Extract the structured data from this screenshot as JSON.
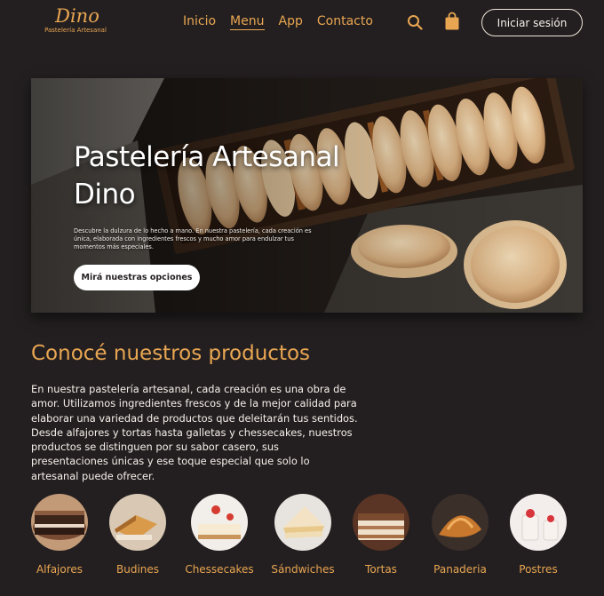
{
  "brand": {
    "name": "Dino",
    "tagline": "Pastelería Artesanal"
  },
  "nav": {
    "items": [
      "Inicio",
      "Menu",
      "App",
      "Contacto"
    ],
    "active": "Menu"
  },
  "header": {
    "search_icon": "search-icon",
    "cart_icon": "shopping-bag-icon",
    "login_label": "Iniciar sesión"
  },
  "colors": {
    "accent": "#e9a652",
    "background": "#231f20",
    "text": "#f5f0ea"
  },
  "hero": {
    "title": "Pastelería Artesanal Dino",
    "description": "Descubre la dulzura de lo hecho a mano. En nuestra pastelería, cada creación es única, elaborada con ingredientes frescos y mucho amor para endulzar tus momentos más especiales.",
    "cta": "Mirá nuestras opciones"
  },
  "products_section": {
    "title": "Conocé nuestros productos",
    "text": "En nuestra pastelería artesanal, cada creación es una obra de amor. Utilizamos ingredientes frescos y de la mejor calidad para elaborar una variedad de productos que deleitarán tus sentidos. Desde alfajores y tortas hasta galletas y chessecakes, nuestros productos se distinguen por su sabor casero, sus presentaciones únicas y ese toque especial que solo lo artesanal puede ofrecer.",
    "categories": [
      "Alfajores",
      "Budines",
      "Chessecakes",
      "Sándwiches",
      "Tortas",
      "Panaderia",
      "Postres"
    ]
  }
}
